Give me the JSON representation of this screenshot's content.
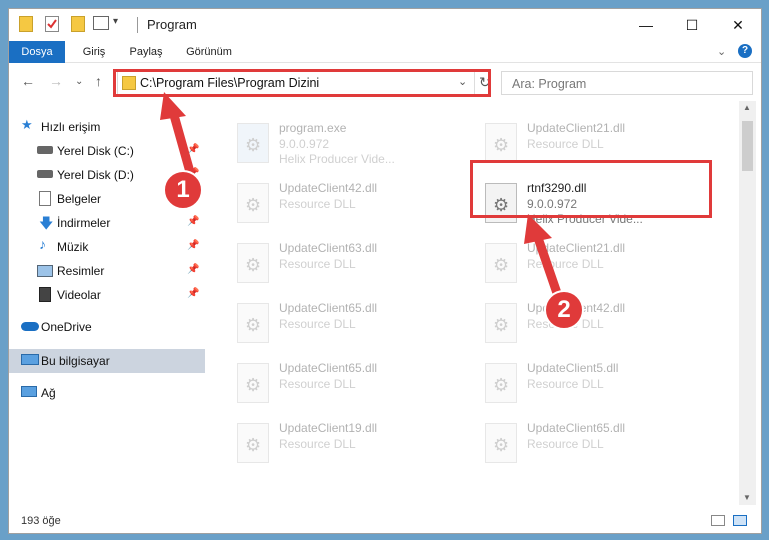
{
  "window": {
    "title": "Program"
  },
  "ribbon": {
    "tabs": [
      "Dosya",
      "Giriş",
      "Paylaş",
      "Görünüm"
    ]
  },
  "address": {
    "path": "C:\\Program Files\\Program Dizini"
  },
  "search": {
    "placeholder": "Ara: Program"
  },
  "sidebar": {
    "items": [
      {
        "label": "Hızlı erişim",
        "icon": "star-icon"
      },
      {
        "label": "Yerel Disk (C:)",
        "icon": "drive-icon",
        "pinned": true
      },
      {
        "label": "Yerel Disk (D:)",
        "icon": "drive-icon",
        "pinned": true
      },
      {
        "label": "Belgeler",
        "icon": "documents-icon",
        "pinned": true
      },
      {
        "label": "İndirmeler",
        "icon": "downloads-icon",
        "pinned": true
      },
      {
        "label": "Müzik",
        "icon": "music-icon",
        "pinned": true
      },
      {
        "label": "Resimler",
        "icon": "pictures-icon",
        "pinned": true
      },
      {
        "label": "Videolar",
        "icon": "videos-icon",
        "pinned": true
      },
      {
        "label": "OneDrive",
        "icon": "cloud-icon"
      },
      {
        "label": "Bu bilgisayar",
        "icon": "computer-icon",
        "selected": true
      },
      {
        "label": "Ağ",
        "icon": "network-icon"
      }
    ]
  },
  "files": [
    {
      "name": "program.exe",
      "line1": "9.0.0.972",
      "line2": "Helix Producer Vide..."
    },
    {
      "name": "UpdateClient21.dll",
      "line1": "Resource DLL",
      "line2": ""
    },
    {
      "name": "UpdateClient42.dll",
      "line1": "Resource DLL",
      "line2": ""
    },
    {
      "name": "rtnf3290.dll",
      "line1": "9.0.0.972",
      "line2": "Helix Producer Vide...",
      "highlighted": true
    },
    {
      "name": "UpdateClient63.dll",
      "line1": "Resource DLL",
      "line2": ""
    },
    {
      "name": "UpdateClient21.dll",
      "line1": "Resource DLL",
      "line2": ""
    },
    {
      "name": "UpdateClient65.dll",
      "line1": "Resource DLL",
      "line2": ""
    },
    {
      "name": "UpdateClient42.dll",
      "line1": "Resource DLL",
      "line2": ""
    },
    {
      "name": "UpdateClient65.dll",
      "line1": "Resource DLL",
      "line2": ""
    },
    {
      "name": "UpdateClient5.dll",
      "line1": "Resource DLL",
      "line2": ""
    },
    {
      "name": "UpdateClient19.dll",
      "line1": "Resource DLL",
      "line2": ""
    },
    {
      "name": "UpdateClient65.dll",
      "line1": "Resource DLL",
      "line2": ""
    }
  ],
  "status": {
    "count": "193 öğe"
  },
  "annotations": {
    "step1": "1",
    "step2": "2",
    "color": "#e03a3a"
  }
}
